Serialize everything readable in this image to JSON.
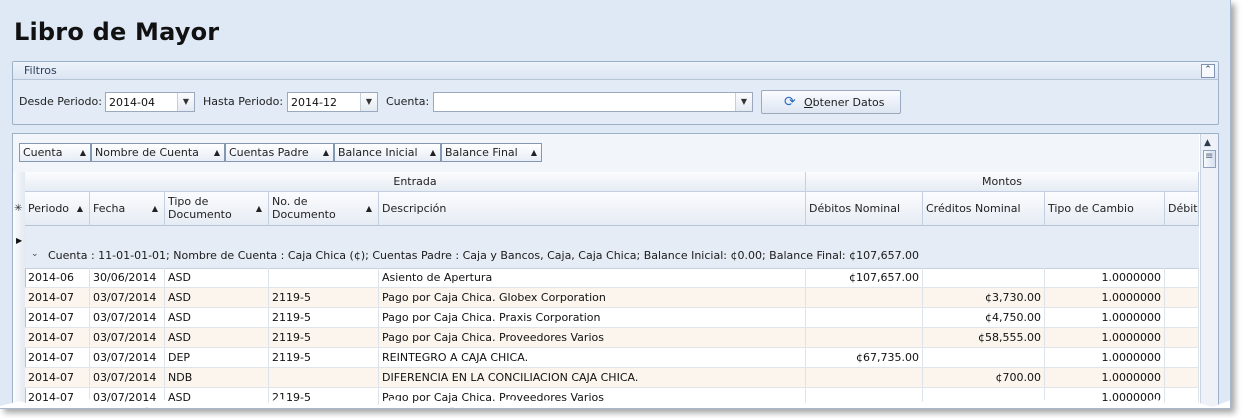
{
  "window": {
    "title": "Libro de Mayor"
  },
  "filters": {
    "title": "Filtros",
    "collapse_icon": "double-chevron-up-icon",
    "desde_label": "Desde Periodo:",
    "desde_value": "2014-04",
    "hasta_label": "Hasta Periodo:",
    "hasta_value": "2014-12",
    "cuenta_label": "Cuenta:",
    "cuenta_value": "",
    "fetch_button_prefix": "",
    "fetch_button_hotkey": "O",
    "fetch_button_rest": "btener Datos"
  },
  "grouping": {
    "chips": [
      "Cuenta",
      "Nombre de Cuenta",
      "Cuentas Padre",
      "Balance Inicial",
      "Balance Final"
    ]
  },
  "grid": {
    "bands": {
      "entrada": "Entrada",
      "montos": "Montos"
    },
    "columns": {
      "periodo": "Periodo",
      "fecha": "Fecha",
      "tipo_doc": "Tipo de Documento",
      "no_doc": "No. de Documento",
      "descripcion": "Descripción",
      "debitos_nominal": "Débitos Nominal",
      "creditos_nominal": "Créditos Nominal",
      "tipo_cambio": "Tipo de Cambio",
      "debitos": "Débito"
    },
    "group_row": "Cuenta  : 11-01-01-01; Nombre de Cuenta : Caja Chica (¢); Cuentas Padre : Caja y Bancos, Caja, Caja Chica; Balance Inicial: ¢0.00; Balance Final: ¢107,657.00",
    "rows": [
      {
        "periodo": "2014-06",
        "fecha": "30/06/2014",
        "tipo": "ASD",
        "no": "",
        "desc": "Asiento de Apertura",
        "deb": "¢107,657.00",
        "cred": "",
        "tc": "1.0000000"
      },
      {
        "periodo": "2014-07",
        "fecha": "03/07/2014",
        "tipo": "ASD",
        "no": "2119-5",
        "desc": "Pago por Caja Chica. Globex Corporation",
        "deb": "",
        "cred": "¢3,730.00",
        "tc": "1.0000000"
      },
      {
        "periodo": "2014-07",
        "fecha": "03/07/2014",
        "tipo": "ASD",
        "no": "2119-5",
        "desc": "Pago por Caja Chica. Praxis Corporation",
        "deb": "",
        "cred": "¢4,750.00",
        "tc": "1.0000000"
      },
      {
        "periodo": "2014-07",
        "fecha": "03/07/2014",
        "tipo": "ASD",
        "no": "2119-5",
        "desc": "Pago por Caja Chica. Proveedores Varios",
        "deb": "",
        "cred": "¢58,555.00",
        "tc": "1.0000000"
      },
      {
        "periodo": "2014-07",
        "fecha": "03/07/2014",
        "tipo": "DEP",
        "no": "2119-5",
        "desc": "REINTEGRO A CAJA CHICA.",
        "deb": "¢67,735.00",
        "cred": "",
        "tc": "1.0000000"
      },
      {
        "periodo": "2014-07",
        "fecha": "03/07/2014",
        "tipo": "NDB",
        "no": "",
        "desc": "DIFERENCIA EN LA CONCILIACION CAJA CHICA.",
        "deb": "",
        "cred": "¢700.00",
        "tc": "1.0000000"
      },
      {
        "periodo": "2014-07",
        "fecha": "03/07/2014",
        "tipo": "ASD",
        "no": "2119-5",
        "desc": "Pago por Caja Chica. Proveedores Varios",
        "deb": "",
        "cred": "",
        "tc": "1.0000000"
      }
    ]
  }
}
